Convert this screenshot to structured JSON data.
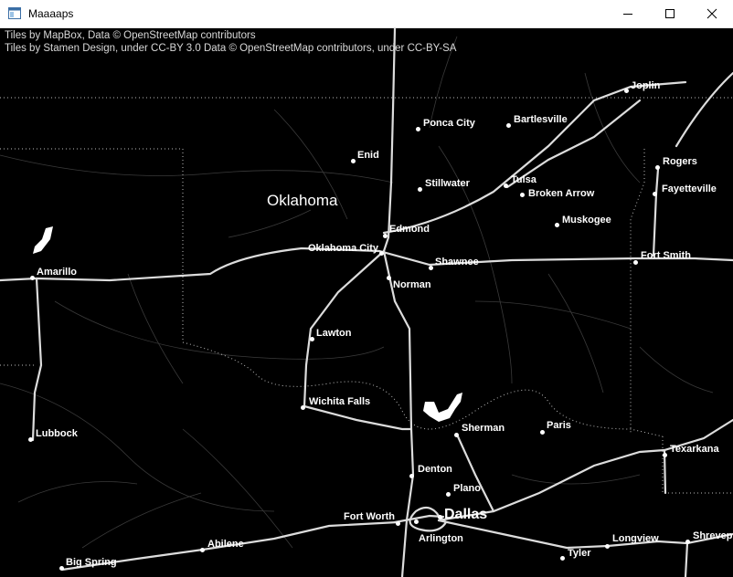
{
  "window": {
    "title": "Maaaaps",
    "icon": "app-window-icon",
    "controls": [
      "minimize-icon",
      "maximize-icon",
      "close-icon"
    ]
  },
  "map": {
    "attribution": [
      "Tiles by MapBox, Data © OpenStreetMap contributors",
      "Tiles by Stamen Design, under CC-BY 3.0 Data © OpenStreetMap contributors, under CC-BY-SA"
    ],
    "region_label": "Oklahoma",
    "cities": [
      {
        "name": "Joplin"
      },
      {
        "name": "Ponca City"
      },
      {
        "name": "Bartlesville"
      },
      {
        "name": "Enid"
      },
      {
        "name": "Rogers"
      },
      {
        "name": "Stillwater"
      },
      {
        "name": "Tulsa"
      },
      {
        "name": "Broken Arrow"
      },
      {
        "name": "Fayetteville"
      },
      {
        "name": "Edmond"
      },
      {
        "name": "Muskogee"
      },
      {
        "name": "Oklahoma City"
      },
      {
        "name": "Amarillo"
      },
      {
        "name": "Shawnee"
      },
      {
        "name": "Fort Smith"
      },
      {
        "name": "Norman"
      },
      {
        "name": "Lawton"
      },
      {
        "name": "Wichita Falls"
      },
      {
        "name": "Sherman"
      },
      {
        "name": "Paris"
      },
      {
        "name": "Lubbock"
      },
      {
        "name": "Texarkana"
      },
      {
        "name": "Denton"
      },
      {
        "name": "Plano"
      },
      {
        "name": "Fort Worth"
      },
      {
        "name": "Dallas"
      },
      {
        "name": "Arlington"
      },
      {
        "name": "Longview"
      },
      {
        "name": "Abilene"
      },
      {
        "name": "Shrevep"
      },
      {
        "name": "Tyler"
      },
      {
        "name": "Big Spring"
      }
    ]
  }
}
